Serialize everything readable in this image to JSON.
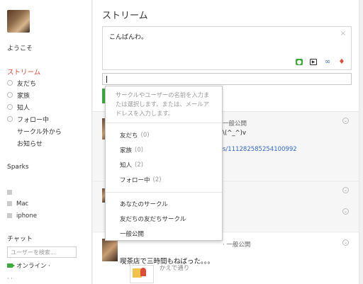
{
  "sidebar": {
    "welcome": "ようこそ",
    "stream": "ストリーム",
    "circles": [
      {
        "label": "友だち"
      },
      {
        "label": "家族"
      },
      {
        "label": "知人"
      },
      {
        "label": "フォロー中"
      },
      {
        "label": "サークル外から"
      },
      {
        "label": "お知らせ"
      }
    ],
    "sparks_title": "Sparks",
    "sparks": [
      {
        "label": "Mac"
      },
      {
        "label": "iphone"
      }
    ],
    "chat_title": "チャット",
    "chat_search_placeholder": "ユーザーを検索...",
    "online_status": "オンライン ·"
  },
  "main": {
    "title": "ストリーム",
    "share_text": "こんばんわ。",
    "close_glyph": "×"
  },
  "feed": {
    "visibility_1": "一般公開",
    "text_frag_1": "\\(^_^)v",
    "link_frag_1": "s/111282585254100992",
    "visibility_2": "· 一般公開",
    "post_text": "喫茶店で三時間もねばった。。。",
    "thumb_caption": "かえで通り"
  },
  "dropdown": {
    "hint": "サークルやユーザーの名前を入力または選択します。または、メールアドレスを入力します。",
    "circles": [
      {
        "label": "友だち",
        "count": "(0)"
      },
      {
        "label": "家族",
        "count": "(0)"
      },
      {
        "label": "知人",
        "count": "(2)"
      },
      {
        "label": "フォロー中",
        "count": "(2)"
      }
    ],
    "options": [
      {
        "label": "あなたのサークル"
      },
      {
        "label": "友だちの友だちサークル"
      },
      {
        "label": "一般公開"
      }
    ]
  },
  "colors": {
    "accent_red": "#dd4b39",
    "google_green": "#3cab3c",
    "link_blue": "#3366cc"
  },
  "icons": [
    "camera-icon",
    "video-icon",
    "link-icon",
    "location-icon",
    "close-icon",
    "collapse-icon"
  ]
}
